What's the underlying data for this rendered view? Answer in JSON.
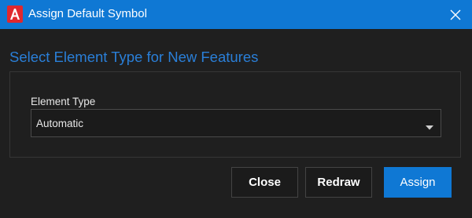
{
  "window": {
    "title": "Assign Default Symbol",
    "app_icon": "autocad-a-icon",
    "close_icon": "close-icon"
  },
  "main": {
    "heading": "Select Element Type for New Features",
    "element_type": {
      "label": "Element Type",
      "value": "Automatic",
      "arrow_icon": "chevron-down-icon"
    }
  },
  "buttons": {
    "close": "Close",
    "redraw": "Redraw",
    "assign": "Assign"
  },
  "colors": {
    "titlebar": "#0f78d4",
    "heading": "#2a7fd8",
    "primary_button": "#0f78d4",
    "background": "#1f1f1f",
    "app_icon": "#e0282e"
  }
}
